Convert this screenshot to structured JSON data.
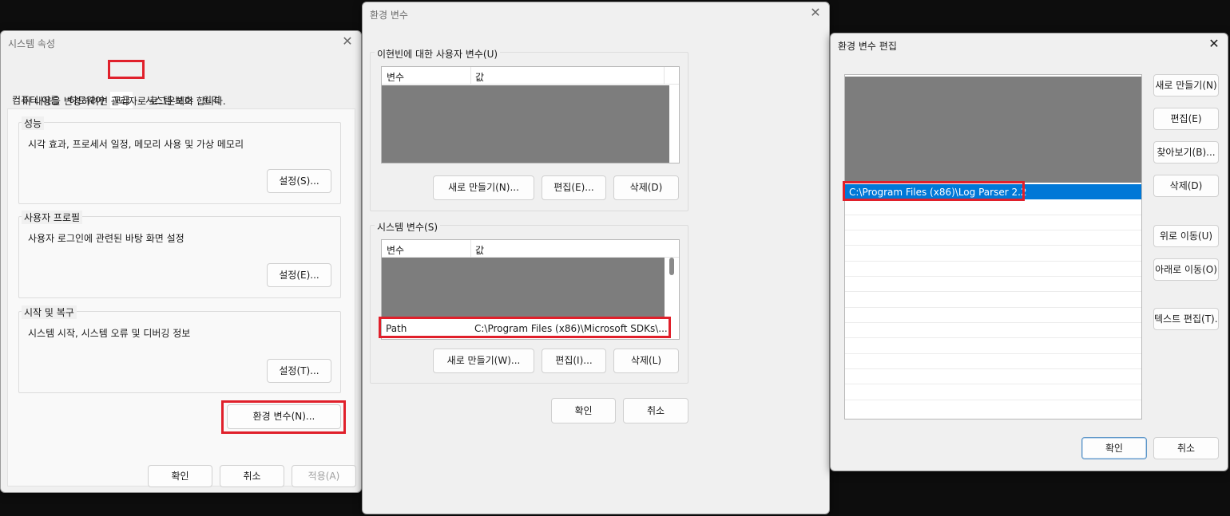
{
  "system_properties": {
    "title": "시스템 속성",
    "tabs": [
      "컴퓨터 이름",
      "하드웨어",
      "고급",
      "시스템 보호",
      "원격"
    ],
    "admin_notice": "이 내용을 변경하려면 관리자로 로그온해야 합니다.",
    "performance": {
      "label": "성능",
      "description": "시각 효과, 프로세서 일정, 메모리 사용 및 가상 메모리",
      "button": "설정(S)..."
    },
    "user_profile": {
      "label": "사용자 프로필",
      "description": "사용자 로그인에 관련된 바탕 화면 설정",
      "button": "설정(E)..."
    },
    "startup_recovery": {
      "label": "시작 및 복구",
      "description": "시스템 시작, 시스템 오류 및 디버깅 정보",
      "button": "설정(T)..."
    },
    "env_button": "환경 변수(N)...",
    "ok": "확인",
    "cancel": "취소",
    "apply": "적용(A)"
  },
  "environment_variables": {
    "title": "환경 변수",
    "user_group_label": "이현빈에 대한 사용자 변수(U)",
    "columns": {
      "variable": "변수",
      "value": "값"
    },
    "user_buttons": {
      "new": "새로 만들기(N)...",
      "edit": "편집(E)...",
      "delete": "삭제(D)"
    },
    "system_group_label": "시스템 변수(S)",
    "system_row": {
      "variable": "Path",
      "value": "C:\\Program Files (x86)\\Microsoft SDKs\\..."
    },
    "system_buttons": {
      "new": "새로 만들기(W)...",
      "edit": "편집(I)...",
      "delete": "삭제(L)"
    },
    "ok": "확인",
    "cancel": "취소"
  },
  "edit_env_variable": {
    "title": "환경 변수 편집",
    "selected_entry": "C:\\Program Files (x86)\\Log Parser 2.2",
    "buttons": {
      "new": "새로 만들기(N)",
      "edit": "편집(E)",
      "browse": "찾아보기(B)...",
      "delete": "삭제(D)",
      "move_up": "위로 이동(U)",
      "move_down": "아래로 이동(O)",
      "edit_text": "텍스트 편집(T)..."
    },
    "ok": "확인",
    "cancel": "취소"
  },
  "colors": {
    "highlight_red": "#e0202b",
    "selection_blue": "#0078d7",
    "redacted_gray": "#7d7d7d"
  }
}
